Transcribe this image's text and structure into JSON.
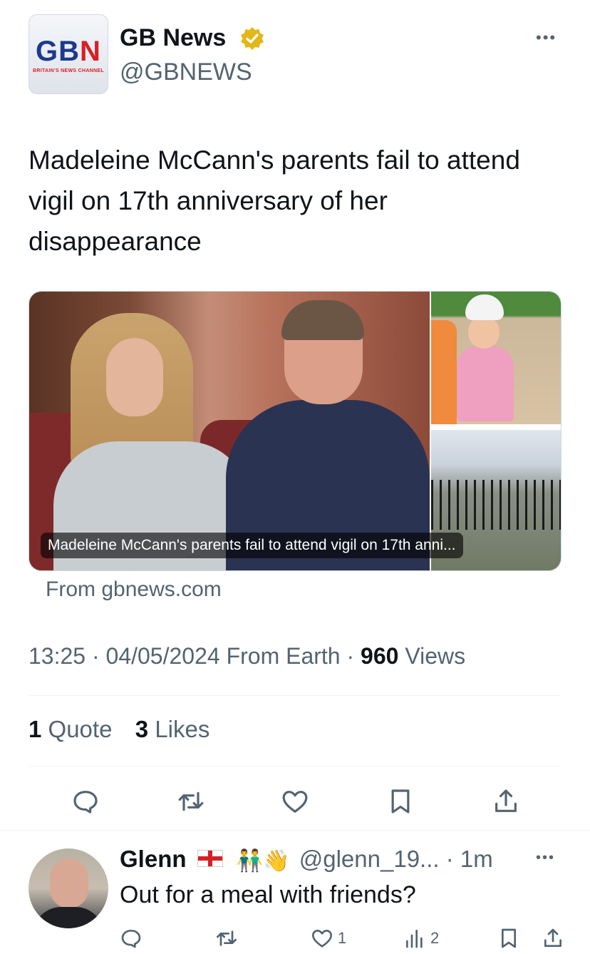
{
  "account": {
    "name": "GB News",
    "handle": "@GBNEWS",
    "logo_text_left": "GB",
    "logo_text_right": "N",
    "logo_subtitle": "BRITAIN'S NEWS CHANNEL",
    "verified_icon": "gold-verified-badge-icon",
    "more_label": "•••"
  },
  "tweet": {
    "text": "Madeleine McCann's parents fail to attend vigil on 17th anniversary of her disappearance",
    "media_caption": "Madeleine McCann's parents fail to attend vigil on 17th anni...",
    "source": "From gbnews.com",
    "time": "13:25",
    "date": "04/05/2024",
    "origin": "From Earth",
    "views_count": "960",
    "views_label": "Views",
    "quotes_count": "1",
    "quotes_label": "Quote",
    "likes_count": "3",
    "likes_label": "Likes"
  },
  "actions": [
    "reply-icon",
    "retweet-icon",
    "like-icon",
    "bookmark-icon",
    "share-icon"
  ],
  "reply": {
    "name": "Glenn",
    "emoji": "👬👋",
    "handle": "@glenn_19...",
    "dot": "·",
    "time": "1m",
    "text": "Out for a meal with friends?",
    "more_label": "•••",
    "likes": "1",
    "views": "2"
  },
  "colors": {
    "text_primary": "#0f1419",
    "text_secondary": "#536471",
    "divider": "#eff3f4",
    "verified_gold": "#e2b719"
  }
}
